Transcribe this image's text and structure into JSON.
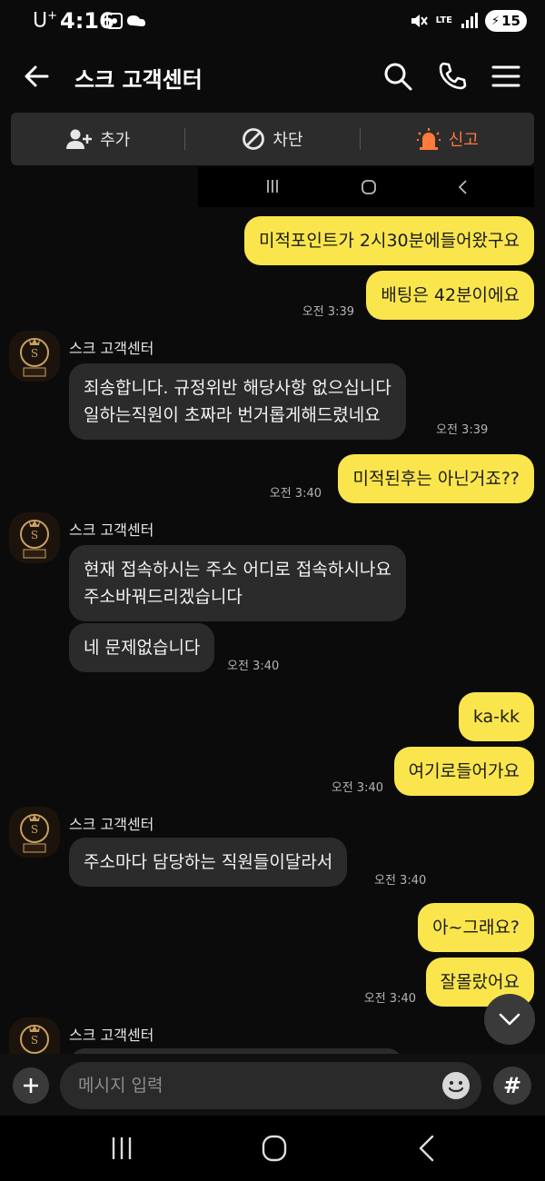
{
  "status": {
    "carrier": "U",
    "carrier_sup": "+",
    "time": "4:16",
    "network": "LTE",
    "battery": "15"
  },
  "header": {
    "title": "스크 고객센터"
  },
  "actions": {
    "add": "추가",
    "block": "차단",
    "report": "신고"
  },
  "messages": [
    {
      "text": "미적포인트가 2시30분에들어왔구요"
    },
    {
      "text": "배팅은 42분이에요",
      "time": "오전 3:39"
    },
    {
      "sender": "스크 고객센터",
      "lines": [
        "죄송합니다. 규정위반 해당사항 없으십니다",
        "일하는직원이 초짜라 번거롭게해드렸네요"
      ],
      "time": "오전 3:39"
    },
    {
      "text": "미적된후는 아닌거죠??",
      "time": "오전 3:40"
    },
    {
      "sender": "스크 고객센터",
      "lines": [
        "현재 접속하시는 주소 어디로 접속하시나요",
        "주소바꿔드리겠습니다"
      ]
    },
    {
      "text": "네 문제없습니다",
      "time": "오전 3:40"
    },
    {
      "text": "ka-kk"
    },
    {
      "text": "여기로들어가요",
      "time": "오전 3:40"
    },
    {
      "sender": "스크 고객센터",
      "text": "주소마다 담당하는 직원들이달라서",
      "time": "오전 3:40"
    },
    {
      "text": "아~그래요?"
    },
    {
      "text": "잘몰랐어요",
      "time": "오전 3:40"
    },
    {
      "sender": "스크 고객센터"
    }
  ],
  "input": {
    "placeholder": "메시지 입력"
  },
  "colors": {
    "my_bubble": "#fae64c",
    "their_bubble": "#2b2b2b",
    "report": "#ff7a3d",
    "background": "#0b0b0b"
  }
}
